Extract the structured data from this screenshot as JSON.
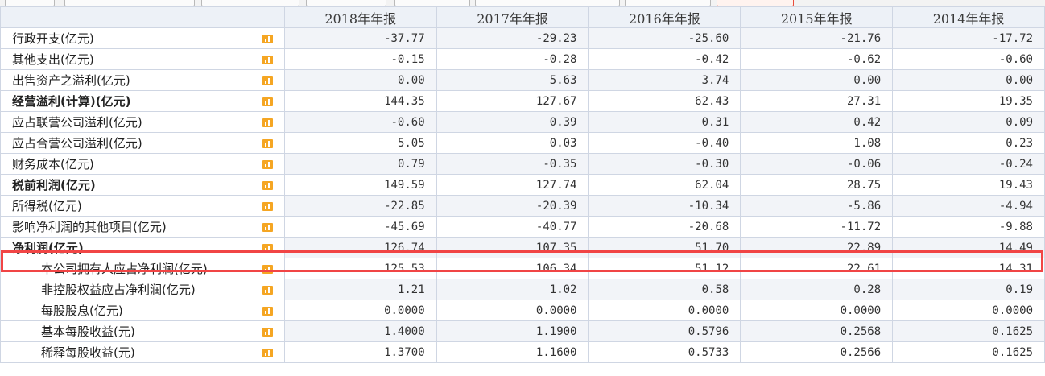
{
  "table": {
    "headers": [
      "2018年年报",
      "2017年年报",
      "2016年年报",
      "2015年年报",
      "2014年年报"
    ],
    "rows": [
      {
        "label": "行政开支(亿元)",
        "values": [
          "-37.77",
          "-29.23",
          "-25.60",
          "-21.76",
          "-17.72"
        ]
      },
      {
        "label": "其他支出(亿元)",
        "values": [
          "-0.15",
          "-0.28",
          "-0.42",
          "-0.62",
          "-0.60"
        ]
      },
      {
        "label": "出售资产之溢利(亿元)",
        "values": [
          "0.00",
          "5.63",
          "3.74",
          "0.00",
          "0.00"
        ]
      },
      {
        "label": "经营溢利(计算)(亿元)",
        "values": [
          "144.35",
          "127.67",
          "62.43",
          "27.31",
          "19.35"
        ]
      },
      {
        "label": "应占联营公司溢利(亿元)",
        "values": [
          "-0.60",
          "0.39",
          "0.31",
          "0.42",
          "0.09"
        ]
      },
      {
        "label": "应占合营公司溢利(亿元)",
        "values": [
          "5.05",
          "0.03",
          "-0.40",
          "1.08",
          "0.23"
        ]
      },
      {
        "label": "财务成本(亿元)",
        "values": [
          "0.79",
          "-0.35",
          "-0.30",
          "-0.06",
          "-0.24"
        ]
      },
      {
        "label": "税前利润(亿元)",
        "values": [
          "149.59",
          "127.74",
          "62.04",
          "28.75",
          "19.43"
        ]
      },
      {
        "label": "所得税(亿元)",
        "values": [
          "-22.85",
          "-20.39",
          "-10.34",
          "-5.86",
          "-4.94"
        ]
      },
      {
        "label": "影响净利润的其他项目(亿元)",
        "values": [
          "-45.69",
          "-40.77",
          "-20.68",
          "-11.72",
          "-9.88"
        ]
      },
      {
        "label": "净利润(亿元)",
        "values": [
          "126.74",
          "107.35",
          "51.70",
          "22.89",
          "14.49"
        ]
      },
      {
        "label": "本公司拥有人应占净利润(亿元)",
        "values": [
          "125.53",
          "106.34",
          "51.12",
          "22.61",
          "14.31"
        ]
      },
      {
        "label": "非控股权益应占净利润(亿元)",
        "values": [
          "1.21",
          "1.02",
          "0.58",
          "0.28",
          "0.19"
        ]
      },
      {
        "label": "每股股息(亿元)",
        "values": [
          "0.0000",
          "0.0000",
          "0.0000",
          "0.0000",
          "0.0000"
        ]
      },
      {
        "label": "基本每股收益(元)",
        "values": [
          "1.4000",
          "1.1900",
          "0.5796",
          "0.2568",
          "0.1625"
        ]
      },
      {
        "label": "稀释每股收益(元)",
        "values": [
          "1.3700",
          "1.1600",
          "0.5733",
          "0.2566",
          "0.1625"
        ]
      }
    ]
  },
  "colors": {
    "highlight": "#f14545",
    "header_bg": "#edf1f7",
    "alt_row_bg": "#f2f4f8",
    "chart_icon": "#f5a623"
  },
  "icons": {
    "row_chart": "bar-chart-icon"
  }
}
